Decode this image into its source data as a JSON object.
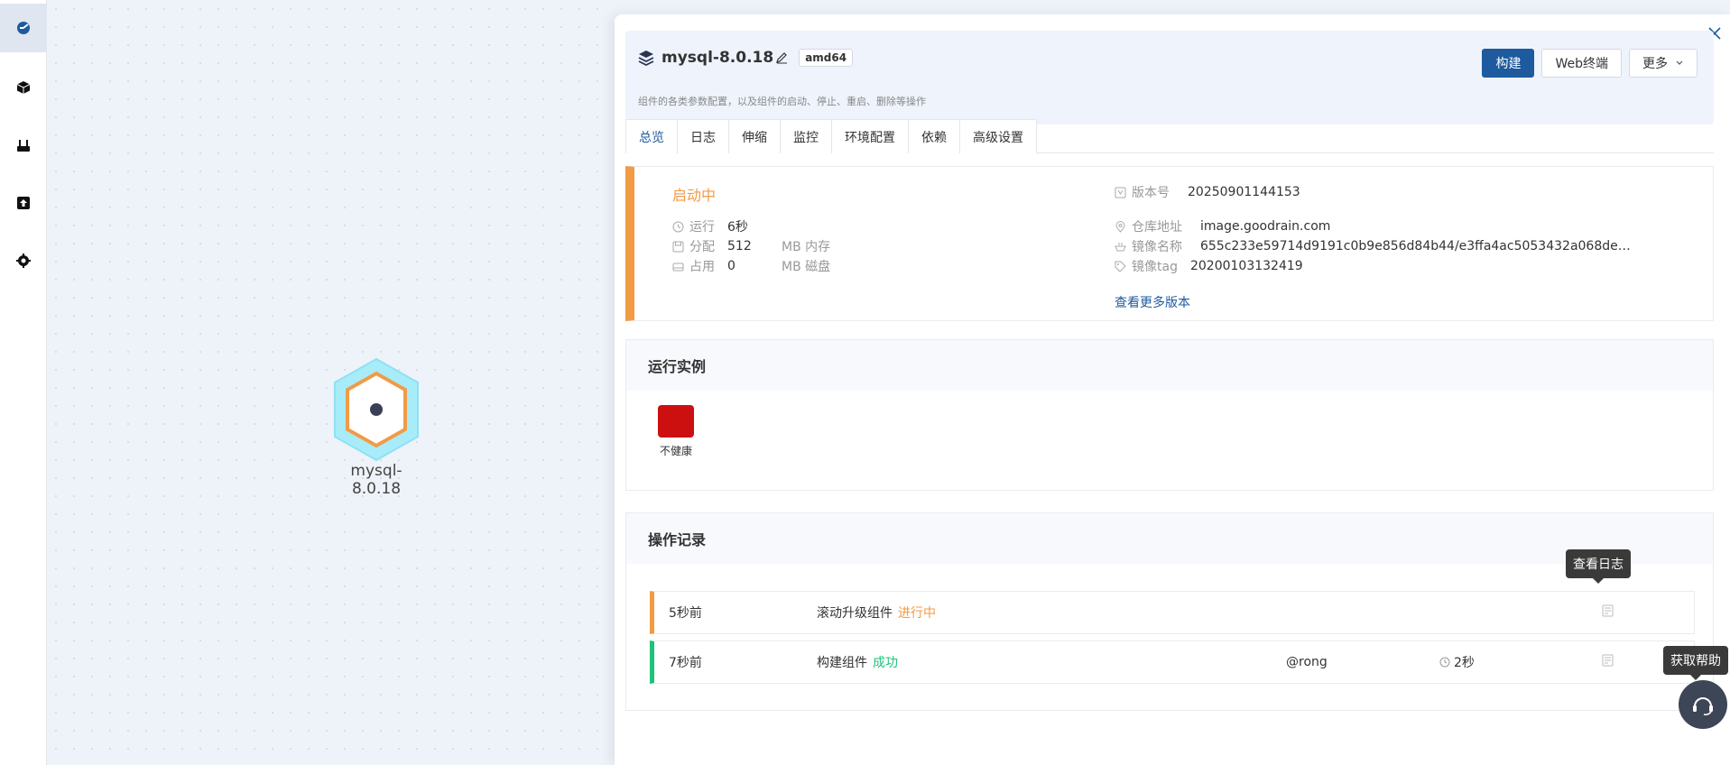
{
  "nav": {
    "items": [
      {
        "icon": "dashboard-icon",
        "active": true
      },
      {
        "icon": "cube-icon",
        "active": false
      },
      {
        "icon": "router-icon",
        "active": false
      },
      {
        "icon": "upload-icon",
        "active": false
      },
      {
        "icon": "gear-icon",
        "active": false
      }
    ]
  },
  "canvas": {
    "node_label": "mysql-8.0.18"
  },
  "drawer": {
    "title": "mysql-8.0.18",
    "arch": "amd64",
    "subtitle": "组件的各类参数配置，以及组件的启动、停止、重启、删除等操作",
    "buttons": {
      "build": "构建",
      "terminal": "Web终端",
      "more": "更多"
    },
    "tabs": [
      "总览",
      "日志",
      "伸缩",
      "监控",
      "环境配置",
      "依赖",
      "高级设置"
    ],
    "status": {
      "state": "启动中",
      "run_label": "运行",
      "run_value": "6秒",
      "alloc_label": "分配",
      "alloc_value": "512",
      "alloc_unit": "MB 内存",
      "used_label": "占用",
      "used_value": "0",
      "used_unit": "MB 磁盘",
      "version_label": "版本号",
      "version_value": "20250901144153",
      "repo_label": "仓库地址",
      "repo_value": "image.goodrain.com",
      "image_label": "镜像名称",
      "image_value": "655c233e59714d9191c0b9e856d84b44/e3ffa4ac5053432a068de…",
      "tag_label": "镜像tag",
      "tag_value": "20200103132419",
      "more_versions": "查看更多版本"
    },
    "instances": {
      "title": "运行实例",
      "items": [
        {
          "label": "不健康",
          "color": "#cc1010"
        }
      ]
    },
    "oplog": {
      "title": "操作记录",
      "rows": [
        {
          "time": "5秒前",
          "action": "滚动升级组件",
          "state": "进行中",
          "user": "",
          "duration": ""
        },
        {
          "time": "7秒前",
          "action": "构建组件",
          "state": "成功",
          "user": "@rong",
          "duration": "2秒"
        }
      ]
    }
  },
  "tooltips": {
    "view_log": "查看日志",
    "help": "获取帮助"
  },
  "colors": {
    "primary": "#1e5a9e",
    "running": "#f29b45",
    "success": "#1ec27a",
    "unhealthy": "#cc1010"
  }
}
